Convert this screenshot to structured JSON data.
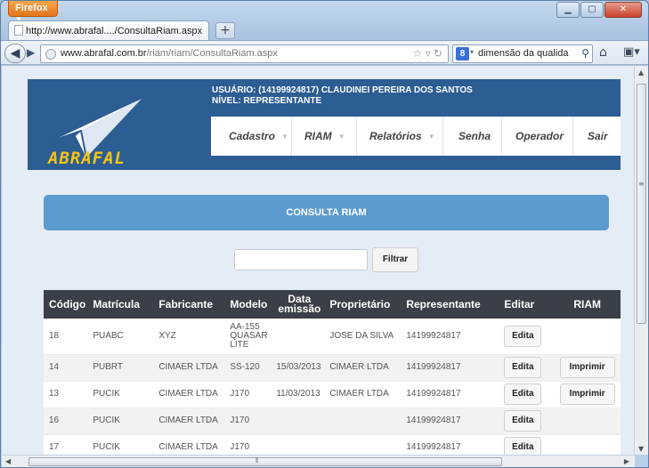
{
  "browser": {
    "menu_button": "Firefox",
    "tab_title": "http://www.abrafal..../ConsultaRiam.aspx",
    "newtab_label": "+",
    "url_domain": "www.abrafal.com.br",
    "url_path": "/riam/riam/ConsultaRiam.aspx",
    "search_text": "dimensão da qualida",
    "search_engine_icon": "google-icon"
  },
  "site": {
    "logo_text": "ABRAFAL",
    "user_line": "USUÁRIO: (14199924817) CLAUDINEI PEREIRA DOS SANTOS",
    "level_line": "NÍVEL: REPRESENTANTE",
    "menu": [
      {
        "label": "Cadastro",
        "has_dropdown": true
      },
      {
        "label": "RIAM",
        "has_dropdown": true
      },
      {
        "label": "Relatórios",
        "has_dropdown": true
      },
      {
        "label": "Senha",
        "has_dropdown": false
      },
      {
        "label": "Operador",
        "has_dropdown": false
      },
      {
        "label": "Sair",
        "has_dropdown": false
      }
    ],
    "panel_title": "CONSULTA RIAM",
    "filter_value": "",
    "filter_button": "Filtrar"
  },
  "table": {
    "headers": [
      "Código",
      "Matrícula",
      "Fabricante",
      "Modelo",
      "Data emissão",
      "Proprietário",
      "Representante",
      "Editar",
      "RIAM"
    ],
    "rows": [
      {
        "codigo": "18",
        "matricula": "PUABC",
        "fabricante": "XYZ",
        "modelo": "AA-155 QUASAR LITE",
        "data": "",
        "proprietario": "JOSE DA SILVA",
        "representante": "14199924817",
        "editar": "Edita",
        "riam": ""
      },
      {
        "codigo": "14",
        "matricula": "PUBRT",
        "fabricante": "CIMAER LTDA",
        "modelo": "SS-120",
        "data": "15/03/2013",
        "proprietario": "CIMAER LTDA",
        "representante": "14199924817",
        "editar": "Edita",
        "riam": "Imprimir"
      },
      {
        "codigo": "13",
        "matricula": "PUCIK",
        "fabricante": "CIMAER LTDA",
        "modelo": "J170",
        "data": "11/03/2013",
        "proprietario": "CIMAER LTDA",
        "representante": "14199924817",
        "editar": "Edita",
        "riam": "Imprimir"
      },
      {
        "codigo": "16",
        "matricula": "PUCIK",
        "fabricante": "CIMAER LTDA",
        "modelo": "J170",
        "data": "",
        "proprietario": "",
        "representante": "14199924817",
        "editar": "Edita",
        "riam": ""
      },
      {
        "codigo": "17",
        "matricula": "PUCIK",
        "fabricante": "CIMAER LTDA",
        "modelo": "J170",
        "data": "",
        "proprietario": "",
        "representante": "14199924817",
        "editar": "Edita",
        "riam": ""
      }
    ]
  },
  "colors": {
    "header_bg": "#2c5d93",
    "panel_bg": "#5b9bcf",
    "table_header_bg": "#3a3f48",
    "logo_text": "#f5c217"
  }
}
